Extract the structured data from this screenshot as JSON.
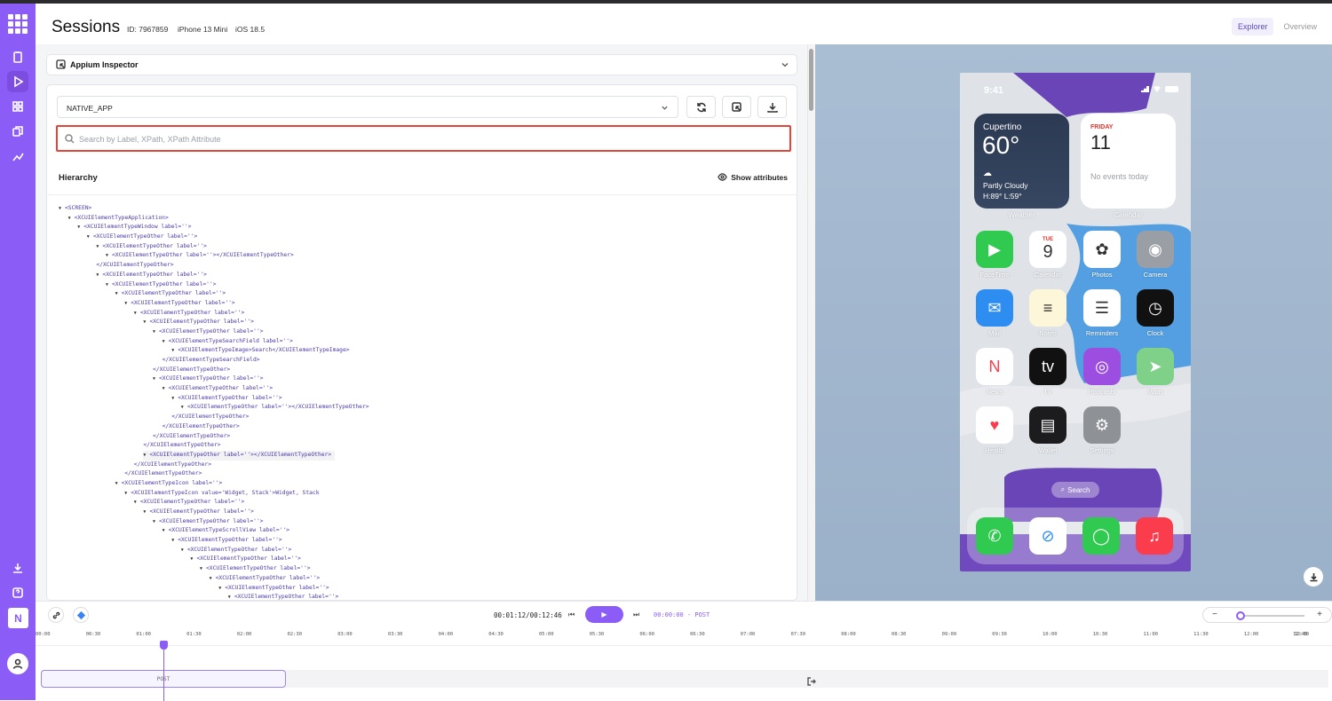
{
  "header": {
    "title": "Sessions",
    "session_id": "ID: 7967859",
    "device": "iPhone 13 Mini",
    "os": "iOS 18.5",
    "tabs": [
      {
        "label": "Explorer"
      },
      {
        "label": "Overview"
      }
    ]
  },
  "sidebar": {
    "org_initial": "N",
    "icons": [
      "apps-grid-icon",
      "clipboard-icon",
      "play-icon",
      "widgets-icon",
      "copy-icon",
      "chart-icon",
      "download-icon",
      "help-icon"
    ]
  },
  "inspector": {
    "label": "Appium Inspector",
    "context": "NATIVE_APP",
    "search_placeholder": "Search by Label, XPath, XPath Attribute",
    "hierarchy_title": "Hierarchy",
    "show_attributes": "Show attributes"
  },
  "tree": [
    {
      "d": 0,
      "a": true,
      "t": "<SCREEN>"
    },
    {
      "d": 1,
      "a": true,
      "t": "<XCUIElementTypeApplication>"
    },
    {
      "d": 2,
      "a": true,
      "t": "<XCUIElementTypeWindow label=''>"
    },
    {
      "d": 3,
      "a": true,
      "t": "<XCUIElementTypeOther label=''>"
    },
    {
      "d": 4,
      "a": true,
      "t": "<XCUIElementTypeOther label=''>"
    },
    {
      "d": 5,
      "a": true,
      "t": "<XCUIElementTypeOther label=''></XCUIElementTypeOther>"
    },
    {
      "d": 4,
      "a": false,
      "t": "</XCUIElementTypeOther>"
    },
    {
      "d": 4,
      "a": true,
      "t": "<XCUIElementTypeOther label=''>"
    },
    {
      "d": 5,
      "a": true,
      "t": "<XCUIElementTypeOther label=''>"
    },
    {
      "d": 6,
      "a": true,
      "t": "<XCUIElementTypeOther label=''>"
    },
    {
      "d": 7,
      "a": true,
      "t": "<XCUIElementTypeOther label=''>"
    },
    {
      "d": 8,
      "a": true,
      "t": "<XCUIElementTypeOther label=''>"
    },
    {
      "d": 9,
      "a": true,
      "t": "<XCUIElementTypeOther label=''>"
    },
    {
      "d": 10,
      "a": true,
      "t": "<XCUIElementTypeOther label=''>"
    },
    {
      "d": 11,
      "a": true,
      "t": "<XCUIElementTypeSearchField label=''>"
    },
    {
      "d": 12,
      "a": true,
      "t": "<XCUIElementTypeImage>Search</XCUIElementTypeImage>"
    },
    {
      "d": 11,
      "a": false,
      "t": "</XCUIElementTypeSearchField>"
    },
    {
      "d": 10,
      "a": false,
      "t": "</XCUIElementTypeOther>"
    },
    {
      "d": 10,
      "a": true,
      "t": "<XCUIElementTypeOther label=''>"
    },
    {
      "d": 11,
      "a": true,
      "t": "<XCUIElementTypeOther label=''>"
    },
    {
      "d": 12,
      "a": true,
      "t": "<XCUIElementTypeOther label=''>"
    },
    {
      "d": 13,
      "a": true,
      "t": "<XCUIElementTypeOther label=''></XCUIElementTypeOther>"
    },
    {
      "d": 12,
      "a": false,
      "t": "</XCUIElementTypeOther>"
    },
    {
      "d": 11,
      "a": false,
      "t": "</XCUIElementTypeOther>"
    },
    {
      "d": 10,
      "a": false,
      "t": "</XCUIElementTypeOther>"
    },
    {
      "d": 9,
      "a": false,
      "t": "</XCUIElementTypeOther>"
    },
    {
      "d": 9,
      "a": true,
      "t": "<XCUIElementTypeOther label=''></XCUIElementTypeOther>",
      "hl": true
    },
    {
      "d": 8,
      "a": false,
      "t": "</XCUIElementTypeOther>"
    },
    {
      "d": 7,
      "a": false,
      "t": "</XCUIElementTypeOther>"
    },
    {
      "d": 6,
      "a": true,
      "t": "<XCUIElementTypeIcon label=''>"
    },
    {
      "d": 7,
      "a": true,
      "t": "<XCUIElementTypeIcon value='Widget, Stack'>Widget, Stack"
    },
    {
      "d": 8,
      "a": true,
      "t": "<XCUIElementTypeOther label=''>"
    },
    {
      "d": 9,
      "a": true,
      "t": "<XCUIElementTypeOther label=''>"
    },
    {
      "d": 10,
      "a": true,
      "t": "<XCUIElementTypeOther label=''>"
    },
    {
      "d": 11,
      "a": true,
      "t": "<XCUIElementTypeScrollView label=''>"
    },
    {
      "d": 12,
      "a": true,
      "t": "<XCUIElementTypeOther label=''>"
    },
    {
      "d": 13,
      "a": true,
      "t": "<XCUIElementTypeOther label=''>"
    },
    {
      "d": 14,
      "a": true,
      "t": "<XCUIElementTypeOther label=''>"
    },
    {
      "d": 15,
      "a": true,
      "t": "<XCUIElementTypeOther label=''>"
    },
    {
      "d": 16,
      "a": true,
      "t": "<XCUIElementTypeOther label=''>"
    },
    {
      "d": 17,
      "a": true,
      "t": "<XCUIElementTypeOther label=''>"
    },
    {
      "d": 18,
      "a": true,
      "t": "<XCUIElementTypeOther label=''>"
    }
  ],
  "phone": {
    "time": "9:41",
    "weather": {
      "city": "Cupertino",
      "temp": "60°",
      "condition": "Partly Cloudy",
      "hilo": "H:89° L:59°",
      "label": "Weather"
    },
    "calendar": {
      "day": "FRIDAY",
      "date": "11",
      "events": "No events today",
      "label": "Calendar"
    },
    "apps": [
      {
        "name": "FaceTime",
        "color": "#2fca4f",
        "glyph": "▶"
      },
      {
        "name": "Calendar",
        "color": "#ffffff",
        "glyph": "9",
        "sub": "TUE"
      },
      {
        "name": "Photos",
        "color": "#ffffff",
        "glyph": "✿"
      },
      {
        "name": "Camera",
        "color": "#9a9ea5",
        "glyph": "◉"
      },
      {
        "name": "Mail",
        "color": "#2d8df0",
        "glyph": "✉"
      },
      {
        "name": "Notes",
        "color": "#fdf6d8",
        "glyph": "≡"
      },
      {
        "name": "Reminders",
        "color": "#ffffff",
        "glyph": "☰"
      },
      {
        "name": "Clock",
        "color": "#111111",
        "glyph": "◷"
      },
      {
        "name": "News",
        "color": "#ffffff",
        "glyph": "N"
      },
      {
        "name": "TV",
        "color": "#111111",
        "glyph": "tv"
      },
      {
        "name": "Podcasts",
        "color": "#9b4ee0",
        "glyph": "◎"
      },
      {
        "name": "Maps",
        "color": "#7fd18a",
        "glyph": "➤"
      },
      {
        "name": "Health",
        "color": "#ffffff",
        "glyph": "♥"
      },
      {
        "name": "Wallet",
        "color": "#1c1c1e",
        "glyph": "▤"
      },
      {
        "name": "Settings",
        "color": "#8e9297",
        "glyph": "⚙"
      }
    ],
    "search_pill": "Search",
    "dock": [
      {
        "name": "Phone",
        "color": "#2fca4f",
        "glyph": "✆"
      },
      {
        "name": "Safari",
        "color": "#ffffff",
        "glyph": "⊘"
      },
      {
        "name": "Messages",
        "color": "#2fca4f",
        "glyph": "◯"
      },
      {
        "name": "Music",
        "color": "#fa3c4c",
        "glyph": "♫"
      }
    ]
  },
  "player": {
    "time": "00:01:12/00:12:46",
    "event": "00:00:00 - POST",
    "track_label": "POST",
    "ticks": [
      "00:00",
      "00:30",
      "01:00",
      "01:30",
      "02:00",
      "02:30",
      "03:00",
      "03:30",
      "04:00",
      "04:30",
      "05:00",
      "05:30",
      "06:00",
      "06:30",
      "07:00",
      "07:30",
      "08:00",
      "08:30",
      "09:00",
      "09:30",
      "10:00",
      "10:30",
      "11:00",
      "11:30",
      "12:00",
      "12:30",
      "12:46"
    ]
  }
}
